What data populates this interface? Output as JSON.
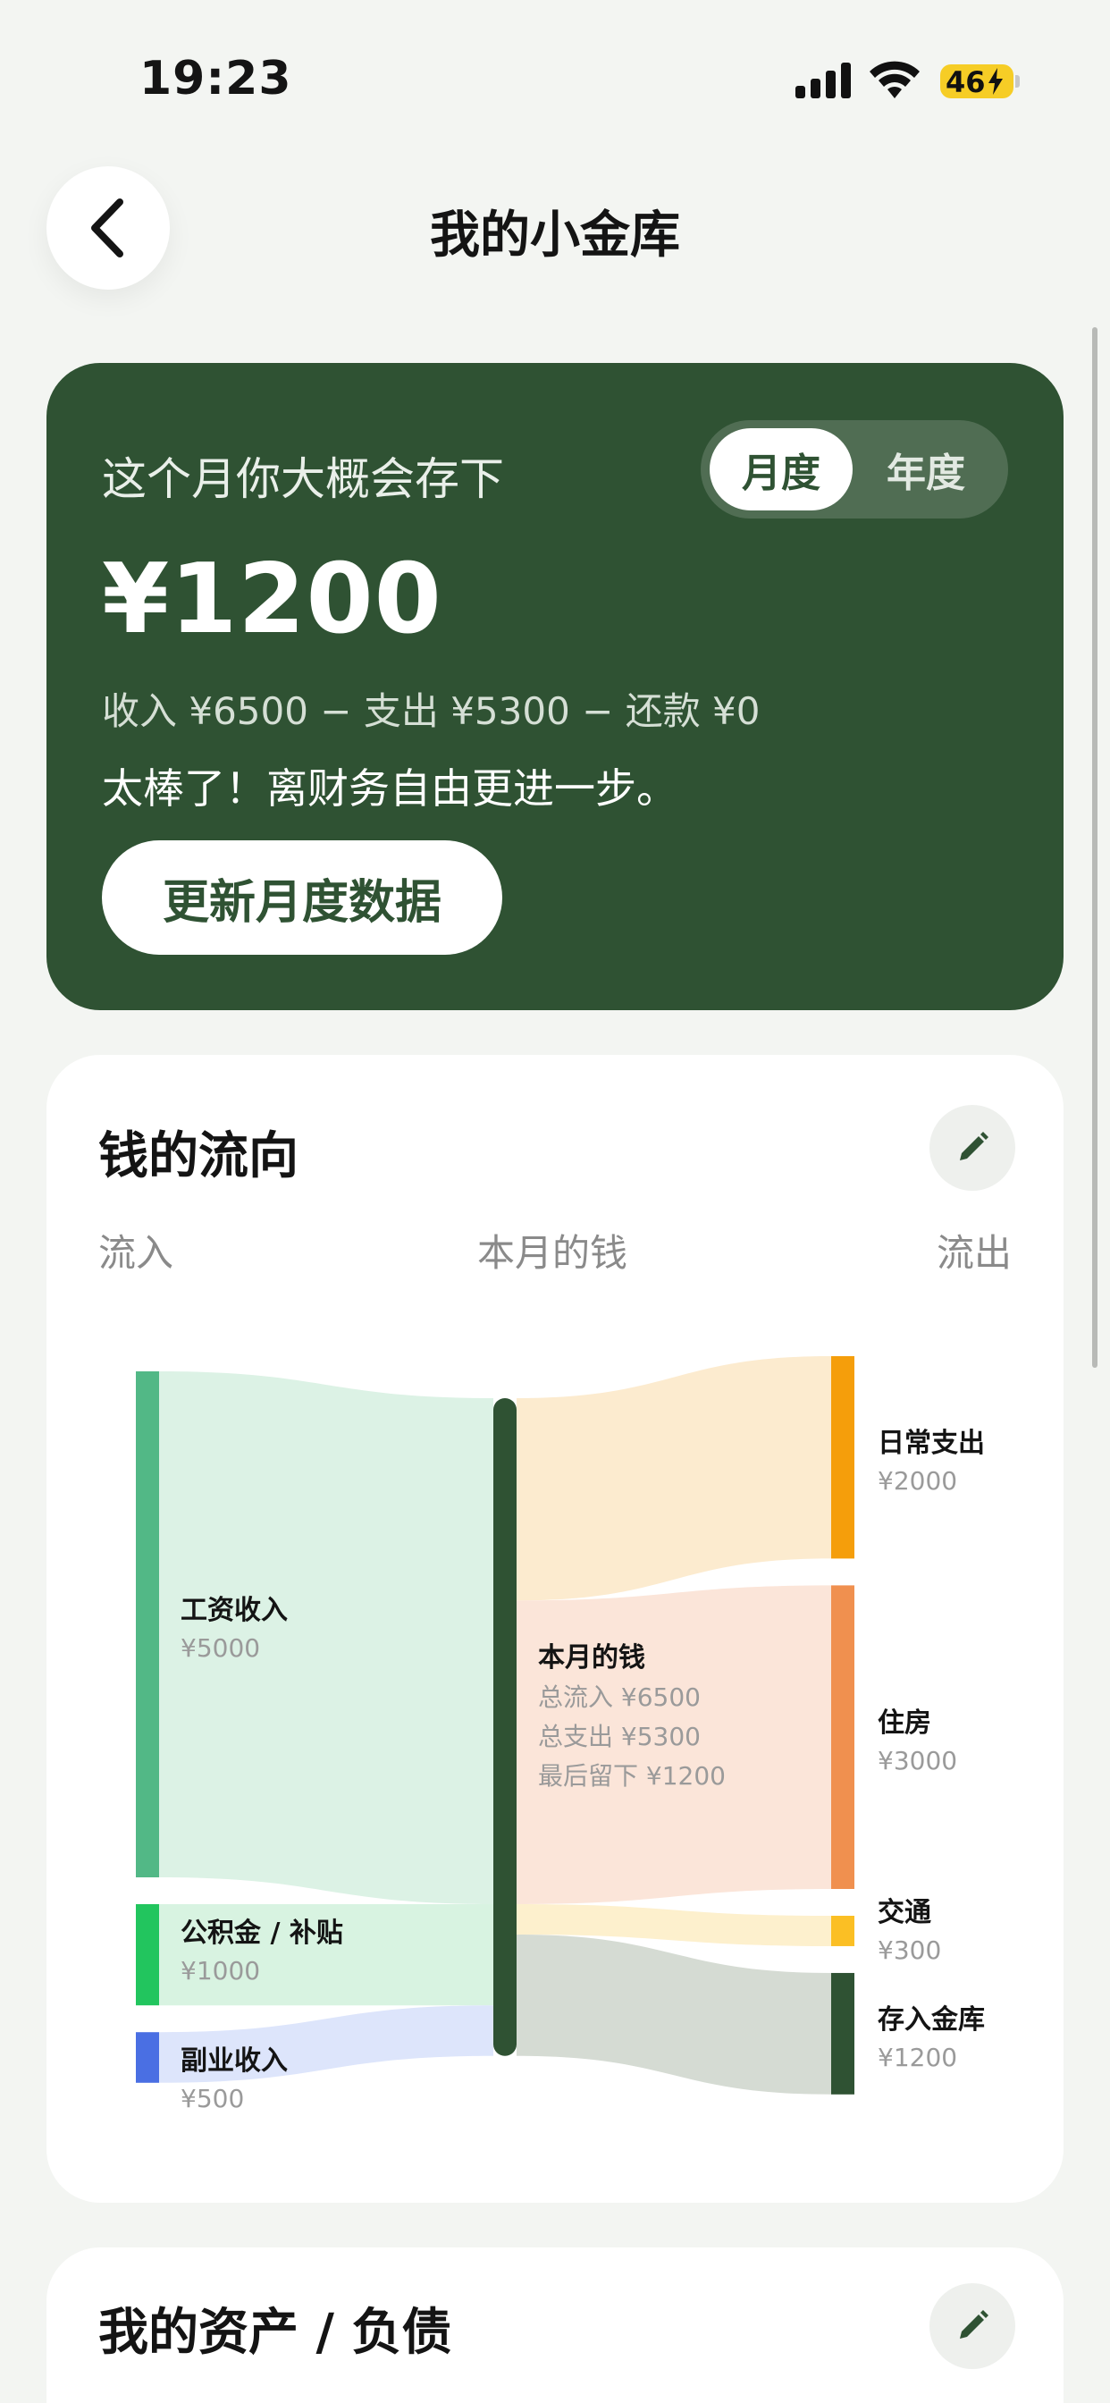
{
  "status_bar": {
    "time": "19:23",
    "battery": "46"
  },
  "header": {
    "title": "我的小金库"
  },
  "summary": {
    "label": "这个月你大概会存下",
    "toggle": {
      "options": [
        "月度",
        "年度"
      ],
      "selected": "月度"
    },
    "amount": "¥1200",
    "formula": "收入 ¥6500 − 支出 ¥5300 − 还款 ¥0",
    "message": "太棒了！离财务自由更进一步。",
    "update_button": "更新月度数据"
  },
  "flow": {
    "title": "钱的流向",
    "columns": {
      "inflow": "流入",
      "center": "本月的钱",
      "outflow": "流出"
    },
    "center": {
      "name": "本月的钱",
      "total_in": "总流入 ¥6500",
      "total_out": "总支出 ¥5300",
      "remaining": "最后留下 ¥1200"
    },
    "sources": [
      {
        "name": "工资收入",
        "value_label": "¥5000",
        "amount": 5000,
        "color": "#52b886",
        "band": "#dcf2e5"
      },
      {
        "name": "公积金 / 补贴",
        "value_label": "¥1000",
        "amount": 1000,
        "color": "#22c55e",
        "band": "#d8f3e1"
      },
      {
        "name": "副业收入",
        "value_label": "¥500",
        "amount": 500,
        "color": "#4a6fe3",
        "band": "#dde5fb"
      }
    ],
    "targets": [
      {
        "name": "日常支出",
        "value_label": "¥2000",
        "amount": 2000,
        "color": "#f59e0b",
        "band": "#fcebcf"
      },
      {
        "name": "住房",
        "value_label": "¥3000",
        "amount": 3000,
        "color": "#f0904f",
        "band": "#fbe5d9"
      },
      {
        "name": "交通",
        "value_label": "¥300",
        "amount": 300,
        "color": "#fbbf24",
        "band": "#fdf0cd"
      },
      {
        "name": "存入金库",
        "value_label": "¥1200",
        "amount": 1200,
        "color": "#2f5233",
        "band": "#d5dbd3"
      }
    ],
    "center_color": "#2f5233"
  },
  "assets": {
    "title": "我的资产 / 负债"
  },
  "icons": {
    "back": "chevron-left-icon",
    "edit": "pencil-icon"
  }
}
